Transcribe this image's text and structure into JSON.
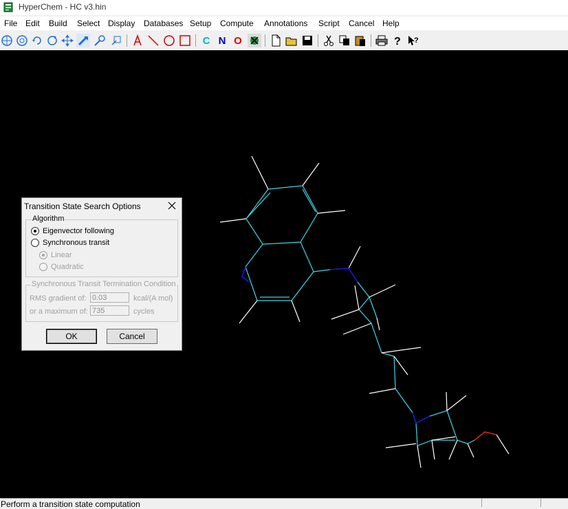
{
  "window": {
    "title": "HyperChem - HC v3.hin"
  },
  "menu": [
    "File",
    "Edit",
    "Build",
    "Select",
    "Display",
    "Databases",
    "Setup",
    "Compute",
    "Annotations",
    "Script",
    "Cancel",
    "Help"
  ],
  "toolbar": {
    "element_letters": {
      "carbon": "C",
      "nitrogen": "N",
      "oxygen": "O"
    },
    "colors": {
      "carbon": "#00b4d8",
      "nitrogen": "#0000c8",
      "oxygen": "#e00000",
      "drawing": "#d00000",
      "tool": "#1f6fd8"
    }
  },
  "dialog": {
    "title": "Transition State Search Options",
    "algorithm_group": "Algorithm",
    "options": {
      "eigenvector": "Eigenvector following",
      "synchronous": "Synchronous transit",
      "linear": "Linear",
      "quadratic": "Quadratic"
    },
    "selected_algorithm": "Eigenvector following",
    "selected_transit": "Linear",
    "termination_group": "Synchronous Transit Termination Condition",
    "rms_label": "RMS gradient of:",
    "rms_value": "0.03",
    "rms_unit": "kcal/(A mol)",
    "max_label": "or a maximum of:",
    "max_value": "735",
    "max_unit": "cycles",
    "ok_label": "OK",
    "cancel_label": "Cancel"
  },
  "status": {
    "text": "Perform a transition state computation"
  },
  "molecule": {
    "bond_colors": {
      "carbon": "#3ed7e6",
      "hydrogen": "#ffffff",
      "nitrogen": "#1a1ad0",
      "oxygen": "#e02020"
    }
  }
}
